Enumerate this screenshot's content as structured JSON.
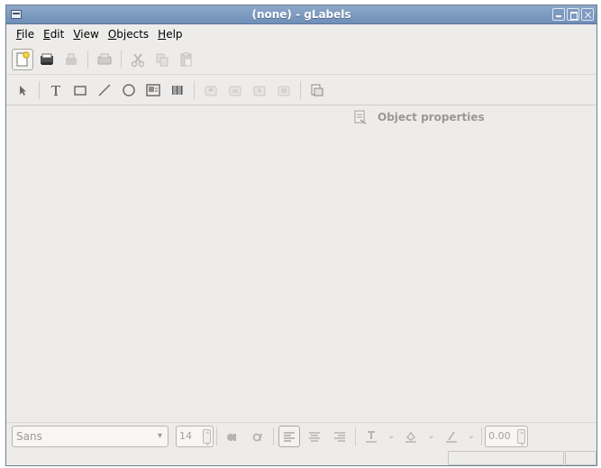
{
  "window": {
    "title": "(none) - gLabels"
  },
  "menubar": {
    "items": [
      {
        "label": "File",
        "accel": "F"
      },
      {
        "label": "Edit",
        "accel": "E"
      },
      {
        "label": "View",
        "accel": "V"
      },
      {
        "label": "Objects",
        "accel": "O"
      },
      {
        "label": "Help",
        "accel": "H"
      }
    ]
  },
  "toolbar_main": {
    "buttons": [
      "new-icon",
      "open-icon",
      "save-icon",
      "print-icon",
      "cut-icon",
      "copy-icon",
      "paste-icon"
    ]
  },
  "toolbar_drawing": {
    "tools": [
      "select-icon",
      "text-tool-icon",
      "box-tool-icon",
      "line-tool-icon",
      "ellipse-tool-icon",
      "image-tool-icon",
      "barcode-tool-icon",
      "raise-icon",
      "lower-icon",
      "rotate-icon",
      "flip-icon",
      "merge-properties-icon"
    ]
  },
  "canvas": {
    "object_properties_label": "Object properties"
  },
  "propbar": {
    "font_family": "Sans",
    "font_size": "14",
    "line_width": "0.00"
  },
  "colors": {
    "titlebar": "#7f9cc2",
    "window_bg": "#edeceb",
    "disabled_text": "#9a9893"
  }
}
